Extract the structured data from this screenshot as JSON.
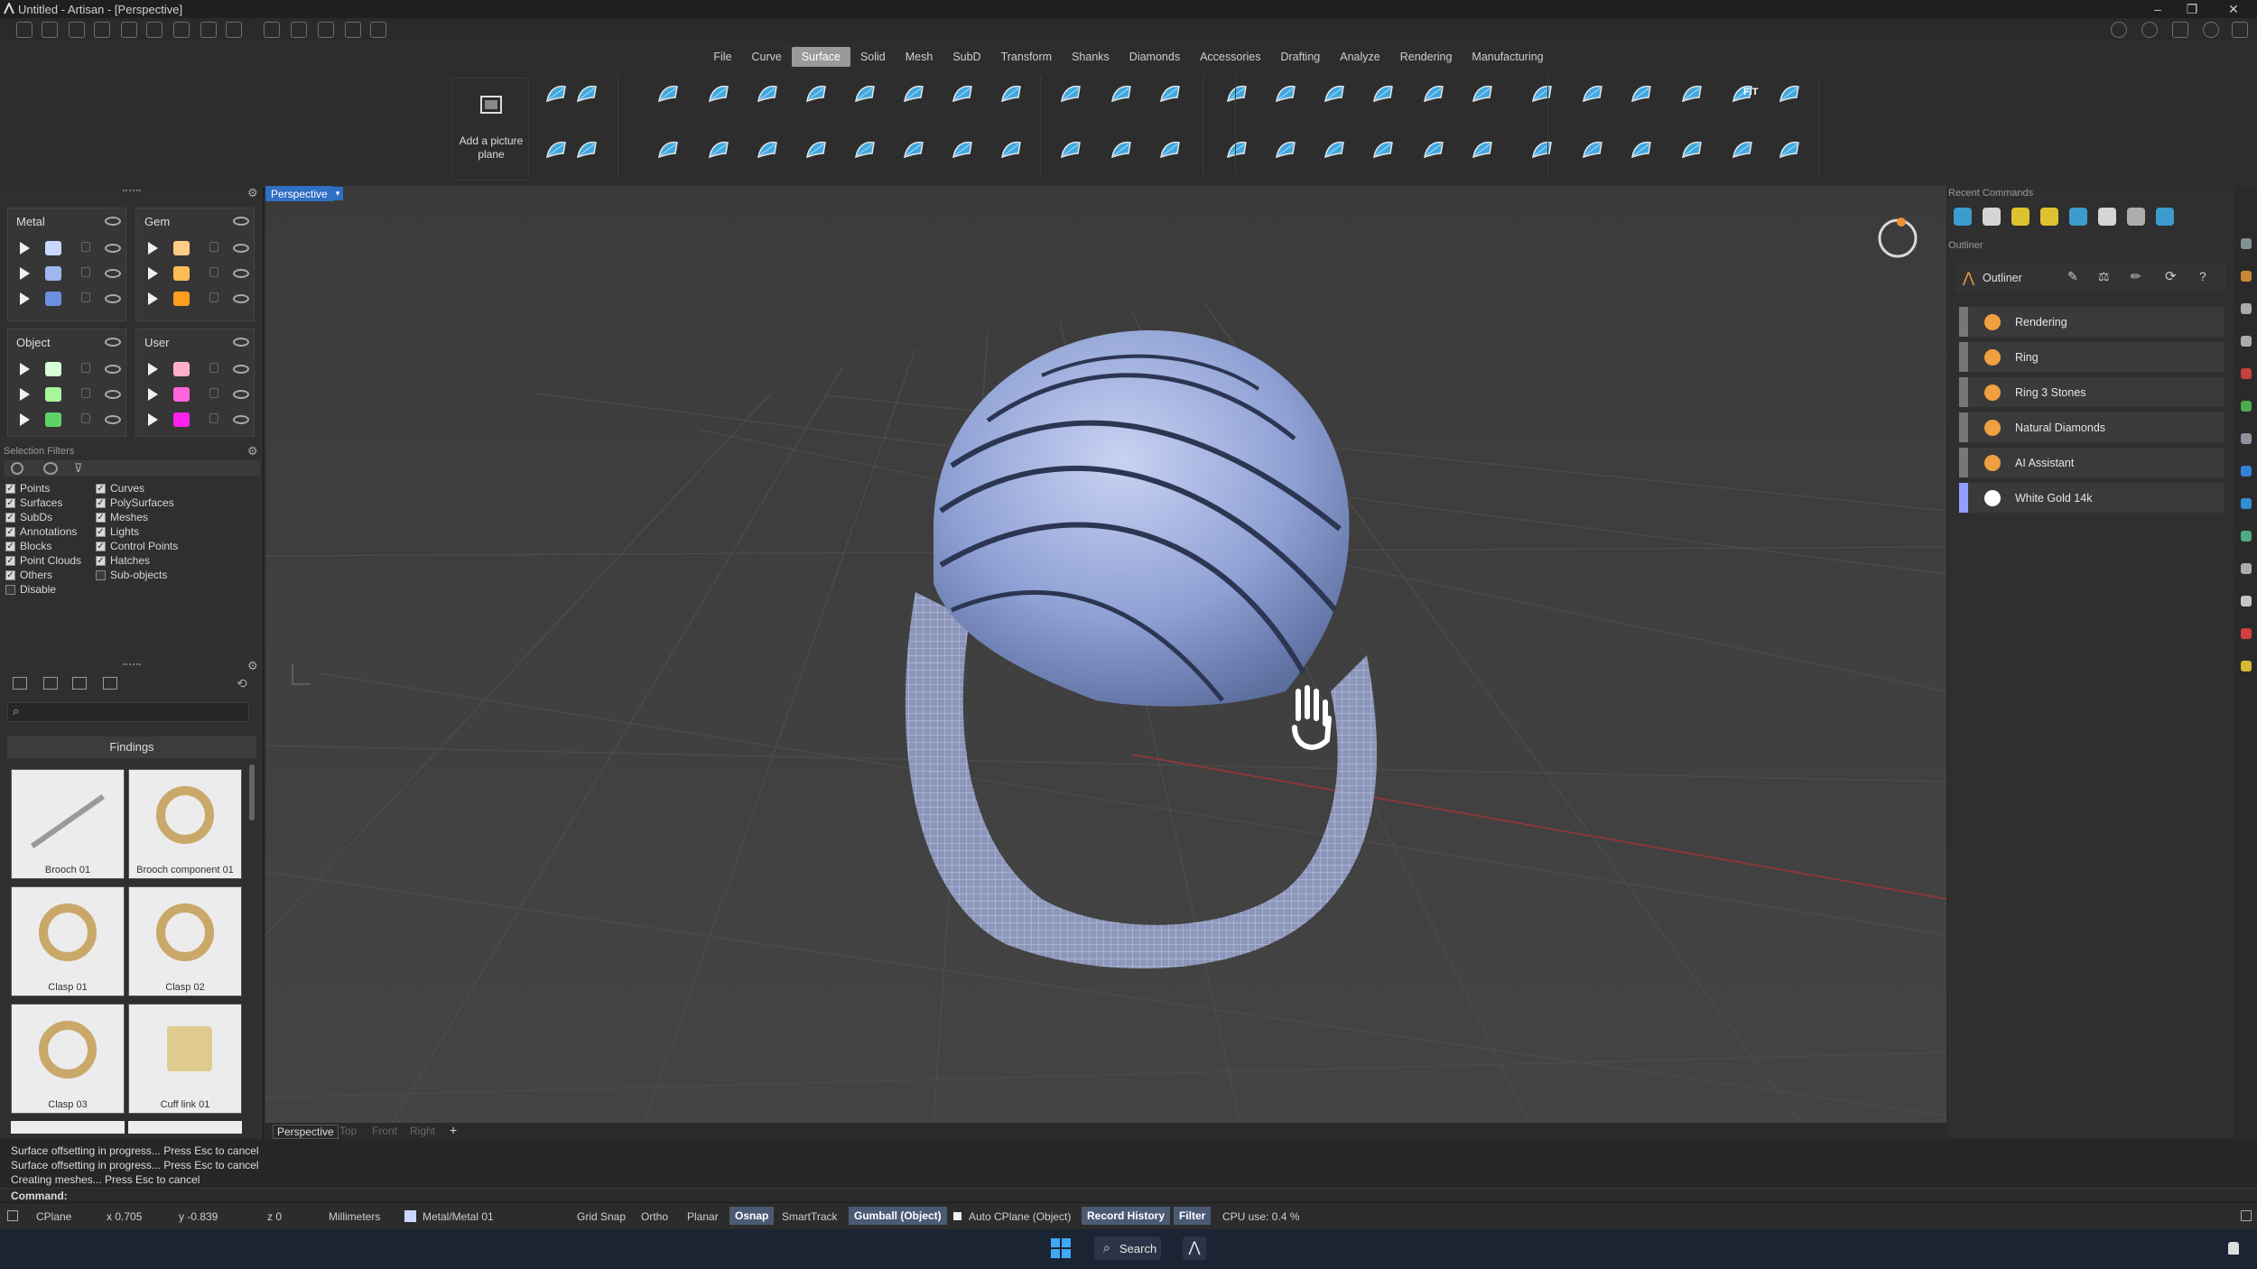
{
  "window": {
    "title": "Untitled - Artisan - [Perspective]",
    "controls": [
      "minimize-icon",
      "restore-icon",
      "close-icon"
    ]
  },
  "ribbon": {
    "tabs": [
      "File",
      "Curve",
      "Surface",
      "Solid",
      "Mesh",
      "SubD",
      "Transform",
      "Shanks",
      "Diamonds",
      "Accessories",
      "Drafting",
      "Analyze",
      "Rendering",
      "Manufacturing"
    ],
    "active_tab": "Surface",
    "picture_plane_label": "Add a picture plane",
    "fit_label": "FIT"
  },
  "layers": {
    "metal": {
      "title": "Metal",
      "colors": [
        "#c9d6ff",
        "#9fb6ef",
        "#6d8fe0"
      ]
    },
    "gem": {
      "title": "Gem",
      "colors": [
        "#ffcc88",
        "#ffbb55",
        "#ff9d1f"
      ]
    },
    "object": {
      "title": "Object",
      "colors": [
        "#d6ffd6",
        "#a9f59a",
        "#5fd36a"
      ]
    },
    "user": {
      "title": "User",
      "colors": [
        "#ffb0c8",
        "#ff66dd",
        "#ff22ee"
      ]
    }
  },
  "selection_filters": {
    "title": "Selection Filters",
    "col1": [
      {
        "label": "Points",
        "on": true
      },
      {
        "label": "Surfaces",
        "on": true
      },
      {
        "label": "SubDs",
        "on": true
      },
      {
        "label": "Annotations",
        "on": true
      },
      {
        "label": "Blocks",
        "on": true
      },
      {
        "label": "Point Clouds",
        "on": true
      },
      {
        "label": "Others",
        "on": true
      },
      {
        "label": "Disable",
        "on": false
      }
    ],
    "col2": [
      {
        "label": "Curves",
        "on": true
      },
      {
        "label": "PolySurfaces",
        "on": true
      },
      {
        "label": "Meshes",
        "on": true
      },
      {
        "label": "Lights",
        "on": true
      },
      {
        "label": "Control Points",
        "on": true
      },
      {
        "label": "Hatches",
        "on": true
      },
      {
        "label": "Sub-objects",
        "on": false
      }
    ]
  },
  "library": {
    "category": "Findings",
    "items": [
      "Brooch 01",
      "Brooch component 01",
      "Clasp 01",
      "Clasp 02",
      "Clasp 03",
      "Cuff link 01"
    ]
  },
  "viewport": {
    "label": "Perspective",
    "tabs": [
      "Perspective",
      "Top",
      "Front",
      "Right"
    ],
    "add_tab": "+"
  },
  "recent_commands": {
    "title": "Recent Commands"
  },
  "outliner": {
    "panel_title": "Outliner",
    "header": "Outliner",
    "rows": [
      {
        "label": "Rendering",
        "icon": "palette-icon",
        "color": "#f0a040"
      },
      {
        "label": "Ring",
        "icon": "ring-icon",
        "color": "#f0a040"
      },
      {
        "label": "Ring 3 Stones",
        "icon": "stones-icon",
        "color": "#f0a040"
      },
      {
        "label": "Natural Diamonds",
        "icon": "diamond-icon",
        "color": "#f0a040"
      },
      {
        "label": "AI Assistant",
        "icon": "assistant-icon",
        "color": "#f0a040"
      },
      {
        "label": "White Gold 14k",
        "icon": "material-icon",
        "color": "#ffffff"
      }
    ],
    "ai_assistant_swatch": "#7fe0a0"
  },
  "command_history": [
    "Surface offsetting in progress... Press Esc to cancel",
    "Surface offsetting in progress... Press Esc to cancel",
    "Creating meshes... Press Esc to cancel"
  ],
  "command_prompt": "Command:",
  "status": {
    "cplane": "CPlane",
    "x": "x 0.705",
    "y": "y -0.839",
    "z": "z 0",
    "units": "Millimeters",
    "layer": "Metal/Metal 01",
    "grid_snap": "Grid Snap",
    "ortho": "Ortho",
    "planar": "Planar",
    "osnap": "Osnap",
    "smarttrack": "SmartTrack",
    "gumball": "Gumball (Object)",
    "auto_cplane": "Auto CPlane (Object)",
    "record_history": "Record History",
    "filter": "Filter",
    "cpu": "CPU use: 0.4 %"
  },
  "taskbar": {
    "search": "Search"
  }
}
